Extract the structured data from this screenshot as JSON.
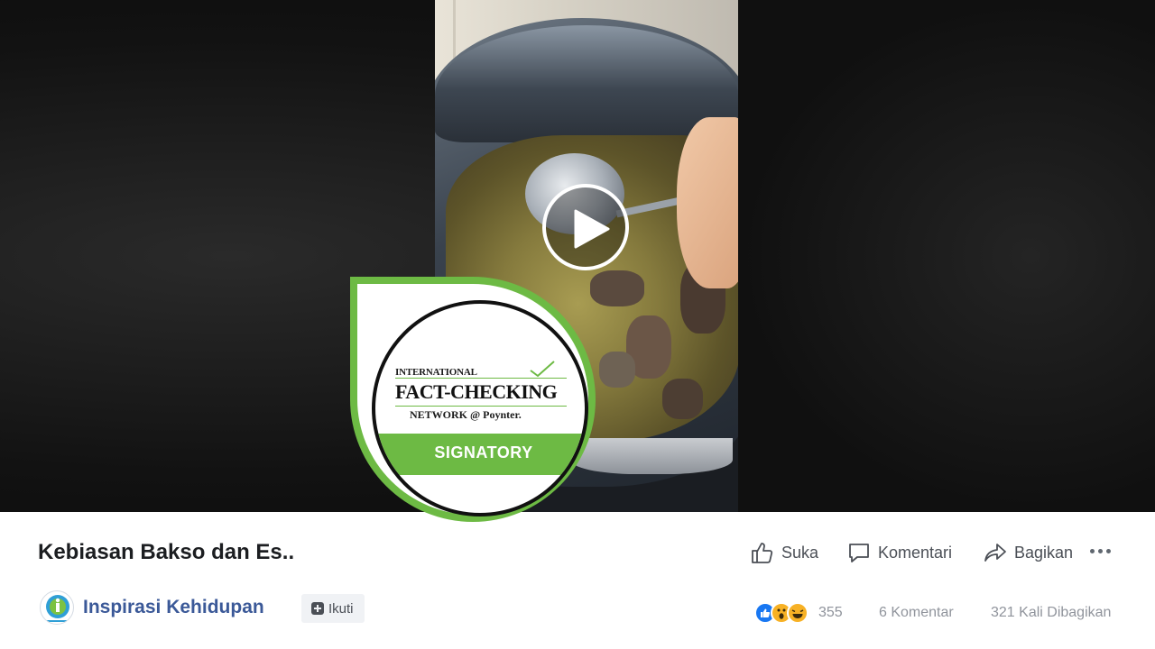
{
  "post": {
    "title": "Kebiasan Bakso dan Es..",
    "page_name": "Inspirasi Kehidupan",
    "follow_label": "Ikuti"
  },
  "actions": {
    "like": "Suka",
    "comment": "Komentari",
    "share": "Bagikan"
  },
  "stats": {
    "reactions_count": "355",
    "comments": "6 Komentar",
    "shares": "321 Kali Dibagikan",
    "reaction_types": [
      "like-icon",
      "wow-icon",
      "haha-icon"
    ]
  },
  "badge": {
    "line1": "INTERNATIONAL",
    "line2": "FACT-CHECKING",
    "line3": "NETWORK @ Poynter.",
    "label": "SIGNATORY"
  },
  "colors": {
    "badge_green": "#6dba44",
    "page_link": "#3b5998",
    "like_blue": "#1877f2",
    "reaction_yellow": "#f7b125"
  }
}
